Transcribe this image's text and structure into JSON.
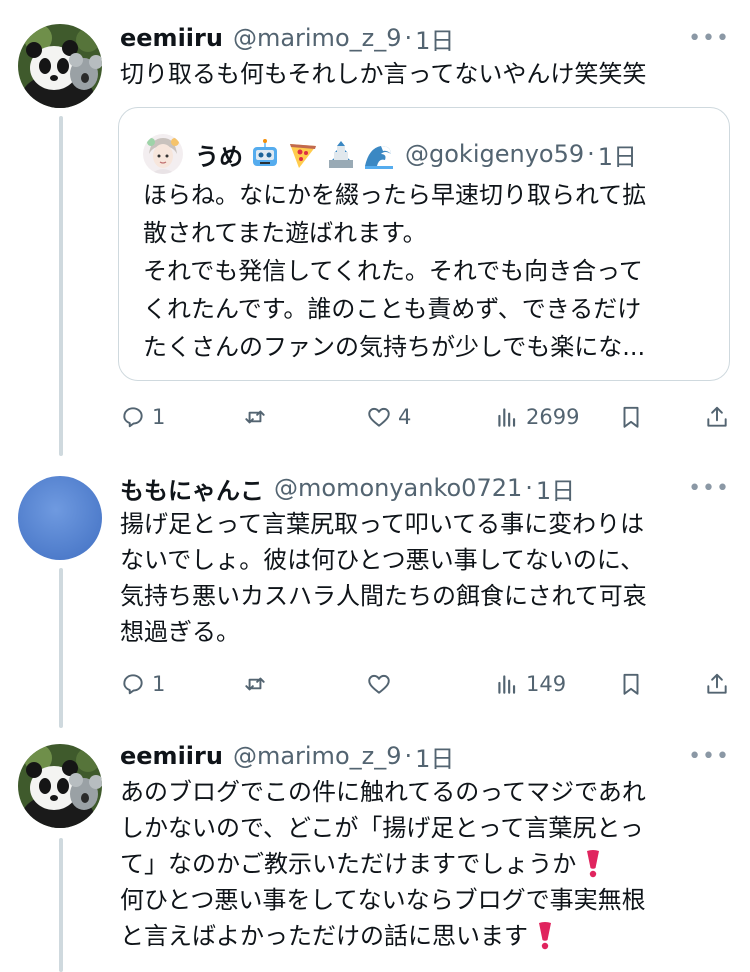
{
  "colors": {
    "text": "#0f1419",
    "secondary": "#536471",
    "border": "#cfd9de",
    "heart_emoji": "#e0245e",
    "avatar_blue": "#5b8bd8"
  },
  "tweets": [
    {
      "name": "eemiiru",
      "handle": "@marimo_z_9",
      "time": "1日",
      "more": "•••",
      "avatar_icon": "panda-koala-avatar",
      "text_lines": [
        "切り取るも何もそれしか言ってないやんけ笑笑笑"
      ],
      "quote": {
        "name": "うめ",
        "name_emojis": [
          "robot-emoji",
          "pizza-emoji",
          "castle-emoji",
          "wave-emoji"
        ],
        "handle": "@gokigenyo59",
        "time": "1日",
        "text_lines": [
          "ほらね。なにかを綴ったら早速切り取られて拡",
          "散されてまた遊ばれます。",
          "それでも発信してくれた。それでも向き合って",
          "くれたんです。誰のことも責めず、できるだけ",
          "たくさんのファンの気持ちが少しでも楽にな..."
        ]
      },
      "actions": {
        "replies": "1",
        "retweets": "",
        "likes": "4",
        "views": "2699"
      }
    },
    {
      "name": "ももにゃんこ",
      "handle": "@momonyanko0721",
      "time": "1日",
      "more": "•••",
      "avatar_icon": "blue-circle-avatar",
      "text_lines": [
        "揚げ足とって言葉尻取って叩いてる事に変わりは",
        "ないでしょ。彼は何ひとつ悪い事してないのに、",
        "気持ち悪いカスハラ人間たちの餌食にされて可哀",
        "想過ぎる。"
      ],
      "actions": {
        "replies": "1",
        "retweets": "",
        "likes": "",
        "views": "149"
      }
    },
    {
      "name": "eemiiru",
      "handle": "@marimo_z_9",
      "time": "1日",
      "more": "•••",
      "avatar_icon": "panda-koala-avatar",
      "text_lines": [
        "あのブログでこの件に触れてるのってマジであれ",
        "しかないので、どこが「揚げ足とって言葉尻とっ",
        "て」なのかご教示いただけますでしょうか",
        "何ひとつ悪い事をしてないならブログで事実無根",
        "と言えばよかっただけの話に思います"
      ],
      "line_emojis": [
        "",
        "",
        "heavy-exclamation-emoji",
        "",
        "heavy-exclamation-emoji"
      ]
    }
  ]
}
